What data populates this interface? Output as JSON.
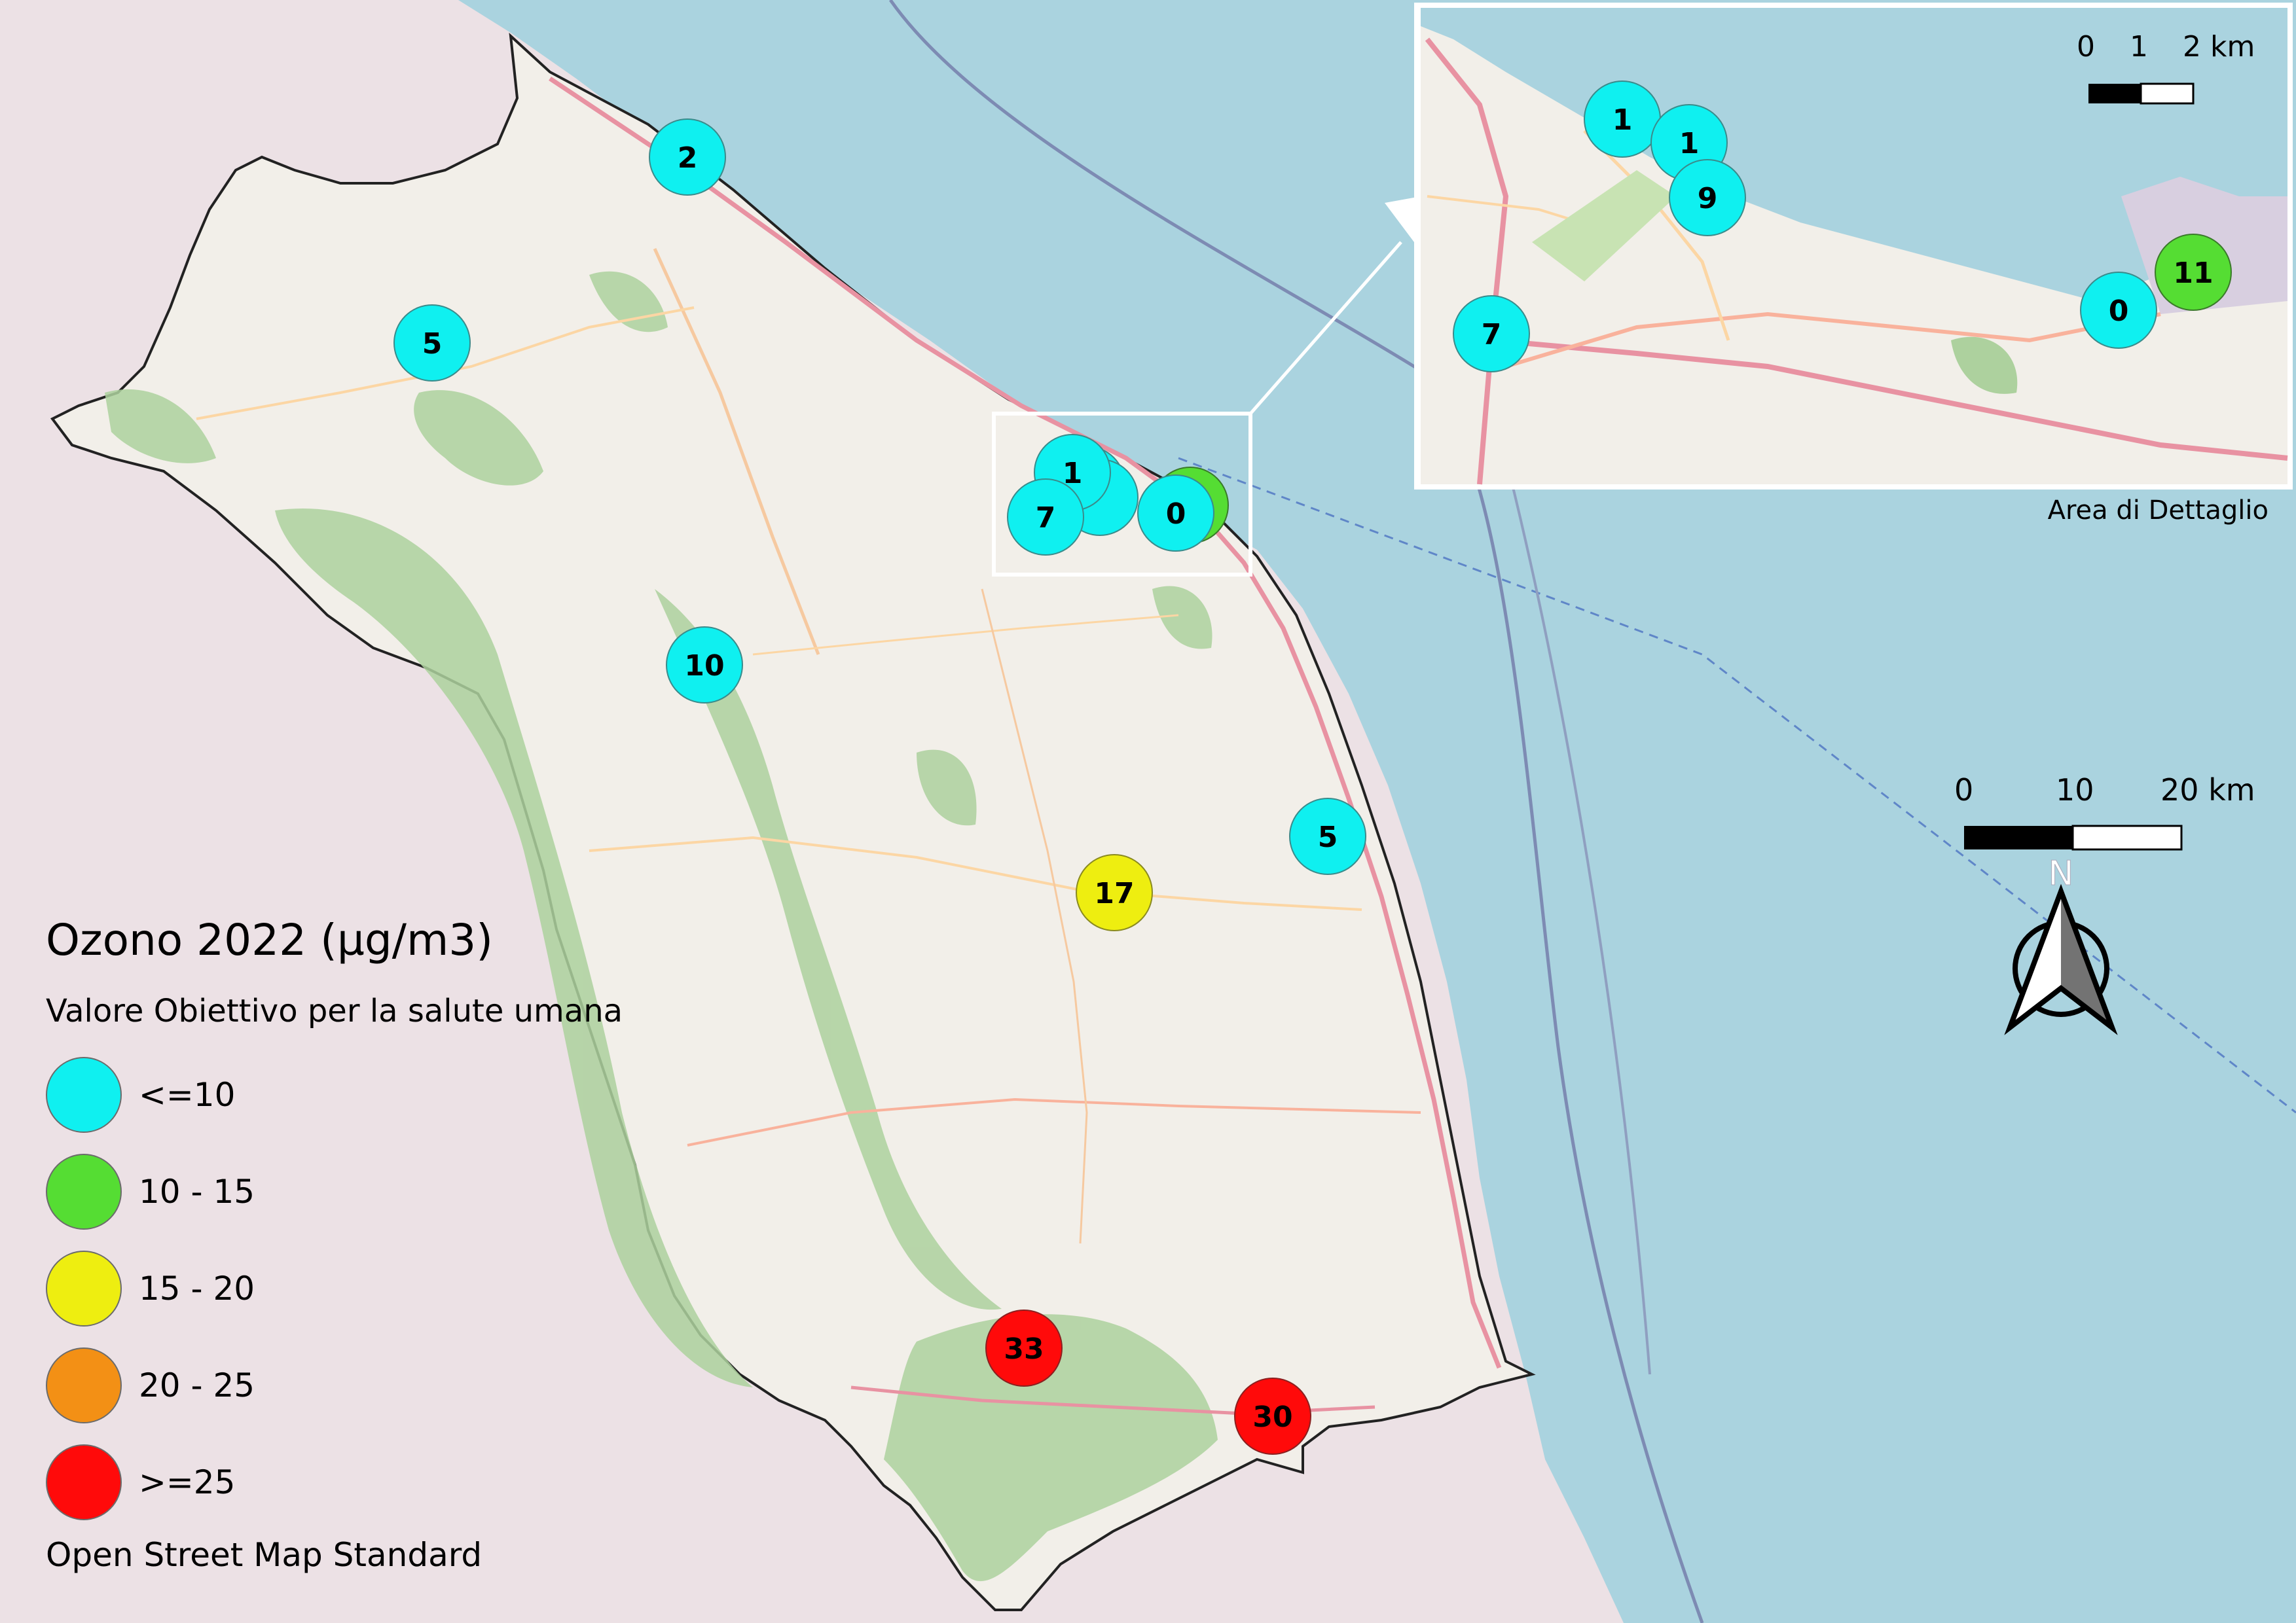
{
  "legend": {
    "title": "Ozono 2022 (µg/m3)",
    "subtitle": "Valore Obiettivo per la salute umana",
    "classes": [
      {
        "label": "<=10",
        "color": "#0ff0f0"
      },
      {
        "label": "10 - 15",
        "color": "#55dd33"
      },
      {
        "label": "15 - 20",
        "color": "#eeee10"
      },
      {
        "label": "20 - 25",
        "color": "#f39015"
      },
      {
        "label": ">=25",
        "color": "#ff0a0a"
      }
    ],
    "source": "Open Street Map Standard"
  },
  "inset": {
    "caption": "Area di Dettaglio",
    "scale_labels": [
      "0",
      "1",
      "2 km"
    ],
    "markers": [
      {
        "value": "1",
        "class": 0
      },
      {
        "value": "1",
        "class": 0
      },
      {
        "value": "9",
        "class": 0
      },
      {
        "value": "7",
        "class": 0
      },
      {
        "value": "0",
        "class": 0
      },
      {
        "value": "11",
        "class": 1
      }
    ]
  },
  "main_scale_labels": [
    "0",
    "10",
    "20 km"
  ],
  "north_label": "N",
  "markers": [
    {
      "value": "2",
      "class": 0
    },
    {
      "value": "5",
      "class": 0
    },
    {
      "value": "10",
      "class": 0
    },
    {
      "value": "1",
      "class": 0
    },
    {
      "value": "7",
      "class": 0
    },
    {
      "value": "0",
      "class": 0
    },
    {
      "value": "5",
      "class": 0
    },
    {
      "value": "17",
      "class": 2
    },
    {
      "value": "33",
      "class": 4
    },
    {
      "value": "30",
      "class": 4
    }
  ],
  "colors": {
    "sea": "#aad3df",
    "land_outside": "#ece1e5",
    "region": "#f2efe9",
    "forest": "#add19e",
    "motorway": "#e892a2"
  }
}
